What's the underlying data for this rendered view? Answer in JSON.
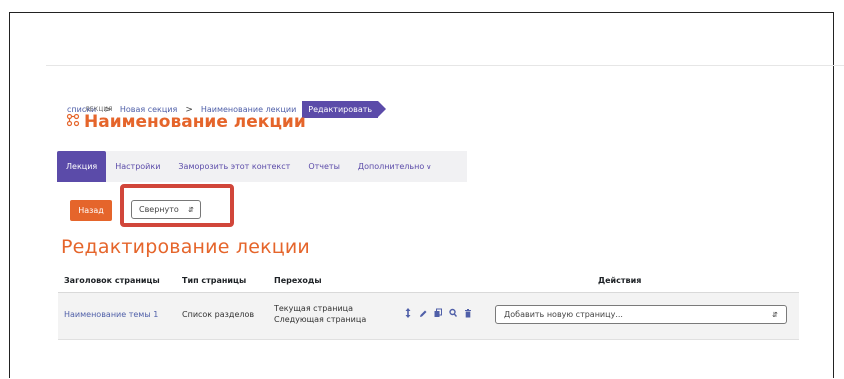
{
  "breadcrumb": {
    "items": [
      "списки",
      "Новая секция",
      "Наименование лекции"
    ],
    "active": "Редактировать"
  },
  "module": {
    "label": "ЛЕКЦИЯ",
    "title": "Наименование лекции",
    "icon": "lesson-icon"
  },
  "tabs": [
    {
      "label": "Лекция",
      "active": true
    },
    {
      "label": "Настройки"
    },
    {
      "label": "Заморозить этот контекст"
    },
    {
      "label": "Отчеты"
    },
    {
      "label": "Дополнительно"
    }
  ],
  "controls": {
    "back_label": "Назад",
    "view_select_value": "Свернуто"
  },
  "section_title": "Редактирование лекции",
  "table": {
    "headers": [
      "Заголовок страницы",
      "Тип страницы",
      "Переходы",
      "Действия"
    ],
    "rows": [
      {
        "title": "Наименование темы 1",
        "type": "Список разделов",
        "transitions": [
          "Текущая страница",
          "Следующая страница"
        ],
        "add_page_value": "Добавить новую страницу..."
      }
    ]
  },
  "colors": {
    "accent": "#e5652b",
    "brand": "#5b4ba9",
    "highlight": "#d1463a"
  }
}
